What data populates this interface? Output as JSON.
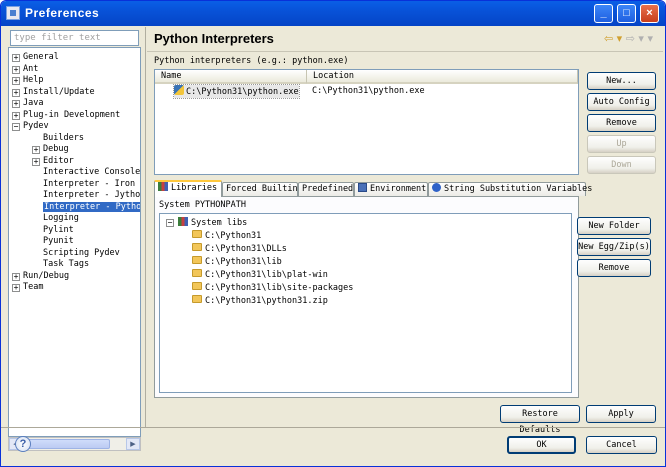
{
  "window": {
    "title": "Preferences",
    "controls": {
      "minimize": "_",
      "maximize": "□",
      "close": "×"
    }
  },
  "filter": {
    "placeholder": "type filter text"
  },
  "tree": {
    "items": [
      {
        "label": "General",
        "expander": "+"
      },
      {
        "label": "Ant",
        "expander": "+"
      },
      {
        "label": "Help",
        "expander": "+"
      },
      {
        "label": "Install/Update",
        "expander": "+"
      },
      {
        "label": "Java",
        "expander": "+"
      },
      {
        "label": "Plug-in Development",
        "expander": "+"
      },
      {
        "label": "Pydev",
        "expander": "−"
      },
      {
        "label": "Builders"
      },
      {
        "label": "Debug",
        "expander": "+"
      },
      {
        "label": "Editor",
        "expander": "+"
      },
      {
        "label": "Interactive Console"
      },
      {
        "label": "Interpreter - Iron Py"
      },
      {
        "label": "Interpreter - Jython"
      },
      {
        "label": "Interpreter - Python",
        "selected": true
      },
      {
        "label": "Logging"
      },
      {
        "label": "Pylint"
      },
      {
        "label": "Pyunit"
      },
      {
        "label": "Scripting Pydev"
      },
      {
        "label": "Task Tags"
      },
      {
        "label": "Run/Debug",
        "expander": "+"
      },
      {
        "label": "Team",
        "expander": "+"
      }
    ]
  },
  "page": {
    "title": "Python Interpreters",
    "nav_back": "⇦ ▾",
    "nav_forward": "⇨ ▾",
    "menu": "▾",
    "section_label": "Python interpreters (e.g.: python.exe)"
  },
  "interpreters": {
    "columns": [
      "Name",
      "Location"
    ],
    "rows": [
      {
        "name": "C:\\Python31\\python.exe",
        "location": "C:\\Python31\\python.exe"
      }
    ]
  },
  "buttons": {
    "new": "New...",
    "auto_config": "Auto Config",
    "remove": "Remove",
    "up": "Up",
    "down": "Down",
    "new_folder": "New Folder",
    "new_egg_zip": "New Egg/Zip(s)",
    "remove_lib": "Remove",
    "restore_defaults": "Restore Defaults",
    "apply": "Apply",
    "ok": "OK",
    "cancel": "Cancel",
    "help": "?"
  },
  "tabs": [
    {
      "label": "Libraries",
      "active": true
    },
    {
      "label": "Forced Builtins"
    },
    {
      "label": "Predefined"
    },
    {
      "label": "Environment"
    },
    {
      "label": "String Substitution Variables"
    }
  ],
  "libraries": {
    "section_label": "System PYTHONPATH",
    "root": {
      "label": "System libs",
      "expander": "−"
    },
    "paths": [
      "C:\\Python31",
      "C:\\Python31\\DLLs",
      "C:\\Python31\\lib",
      "C:\\Python31\\lib\\plat-win",
      "C:\\Python31\\lib\\site-packages",
      "C:\\Python31\\python31.zip"
    ]
  },
  "colors": {
    "titlebar": "#0852d8",
    "selection": "#316ac5",
    "active_tab_accent": "#ffc83c",
    "dialog_bg": "#ece9d8"
  },
  "icons": {
    "interpreter": "python-icon",
    "libraries_tab": "books-icon",
    "environment_tab": "monitor-icon",
    "string_sub_tab": "blue-dot-icon",
    "lib_root": "books-icon",
    "lib_path": "folder-icon",
    "help": "help-icon"
  }
}
